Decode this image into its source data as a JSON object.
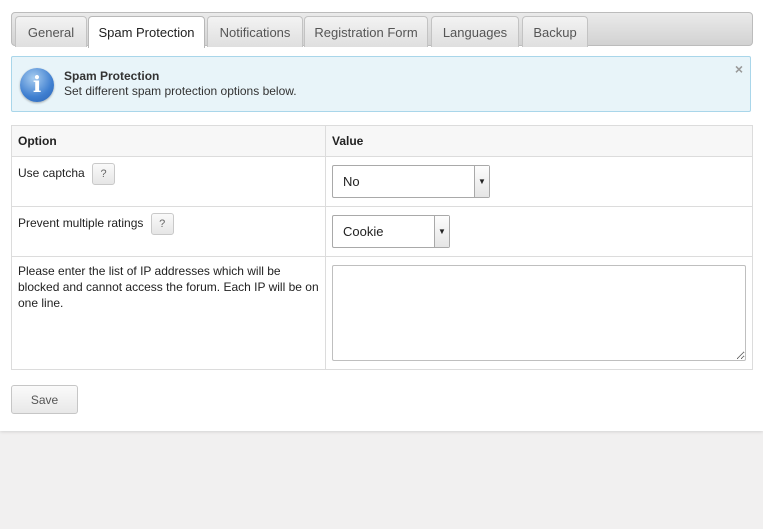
{
  "tabs": [
    {
      "label": "General"
    },
    {
      "label": "Spam Protection",
      "active": true
    },
    {
      "label": "Notifications"
    },
    {
      "label": "Registration Form"
    },
    {
      "label": "Languages"
    },
    {
      "label": "Backup"
    }
  ],
  "info": {
    "title": "Spam Protection",
    "text": "Set different spam protection options below.",
    "icon": "info-icon",
    "close_glyph": "×"
  },
  "table": {
    "headers": [
      "Option",
      "Value"
    ],
    "rows": [
      {
        "label": "Use captcha",
        "help": "?",
        "value": "No"
      },
      {
        "label": "Prevent multiple ratings",
        "help": "?",
        "value": "Cookie"
      },
      {
        "label": "Please enter the list of IP addresses which will be blocked and cannot access the forum. Each IP will be on one line.",
        "value": ""
      }
    ]
  },
  "save_label": "Save",
  "colors": {
    "info_bg": "#e8f4f9",
    "info_border": "#a9d6ea",
    "page_bg": "#f1f0f0"
  }
}
